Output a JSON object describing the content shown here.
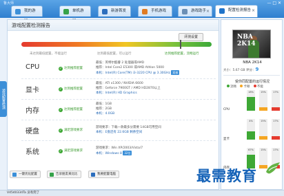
{
  "app": {
    "brand": "鲁大师",
    "window_controls": "— □ ✕"
  },
  "tabs": [
    {
      "label": "我的游戏",
      "color": "#3b8fd8"
    },
    {
      "label": "单机游戏",
      "color": "#35a24a"
    },
    {
      "label": "新游首发",
      "color": "#2c6ebd"
    },
    {
      "label": "手机游戏",
      "color": "#e07b22"
    },
    {
      "label": "游戏助手",
      "color": "#6b8fb5"
    },
    {
      "label": "配置检测报告",
      "color": "#1f73c9"
    }
  ],
  "vertical_tab": "游戏配置检测",
  "report": {
    "title": "游戏配置检测报告",
    "score_button": "评测设置",
    "bar_labels": [
      "未达到最低配置，不能运行",
      "达到最低配置，可以运行",
      "达到推荐配置，流畅运行"
    ],
    "rows": [
      {
        "name": "CPU",
        "status": "达到推荐配置",
        "lines": [
          "最低：英特尔酷睿 2 处理器或AMD",
          "推荐：Intel Core2 E5300 或AMD Athlon 5000",
          "本机：Intel(R) Core(TM) i3-3220 CPU @ 3.30GHz"
        ],
        "chip": "双核"
      },
      {
        "name": "显卡",
        "status": "达到推荐配置",
        "lines": [
          "最低：ATI x1300 / NVIDIA 6600",
          "推荐：Geforce 7900GT / AMD HD2870以上",
          "本机：Intel(R) HD Graphics"
        ]
      },
      {
        "name": "内存",
        "status": "达到推荐配置",
        "lines": [
          "最低：1GB",
          "推荐：2GB",
          "本机：4.0GB"
        ]
      },
      {
        "name": "硬盘",
        "status": "满足游戏要求",
        "lines": [
          "游戏要求：下载一款最多分需要 14GB可用空间",
          "本机：E盘还有 22.6GB 剩余空间"
        ]
      },
      {
        "name": "系统",
        "status": "满足游戏要求",
        "lines": [
          "游戏要求：Win XP/2003/Vista/7",
          "本机：Windows 8"
        ],
        "chip": "32位"
      }
    ],
    "footer_buttons": [
      "一键优化配置",
      "告诉朋友来比比",
      "我要配置电脑"
    ]
  },
  "side": {
    "header": "NBA 2K14",
    "game_name": "NBA 2K14",
    "size_label": "大小：5.67 GB",
    "rating_label": "评分：",
    "rating": "9",
    "section_title": "受你同配置的运行情况",
    "legend": [
      {
        "label": "流畅",
        "color": "#3ea835"
      },
      {
        "label": "卡顿",
        "color": "#f5a623"
      },
      {
        "label": "不能",
        "color": "#e53b2f"
      }
    ],
    "metrics": [
      {
        "name": "CPU",
        "pcts": [
          "18%",
          "15%",
          "17%"
        ],
        "values": [
          0.66,
          0.15,
          0.17
        ]
      },
      {
        "name": "显卡",
        "pcts": [
          "4%",
          "15%",
          "17%"
        ],
        "values": [
          0.4,
          0.15,
          0.17
        ]
      },
      {
        "name": "内存",
        "pcts": [
          "67%",
          "15%",
          "17%"
        ],
        "values": [
          0.67,
          0.15,
          0.17
        ]
      }
    ]
  },
  "statusbar": {
    "text": "V4540334Ta 没有完了"
  },
  "watermark": "最需教育"
}
